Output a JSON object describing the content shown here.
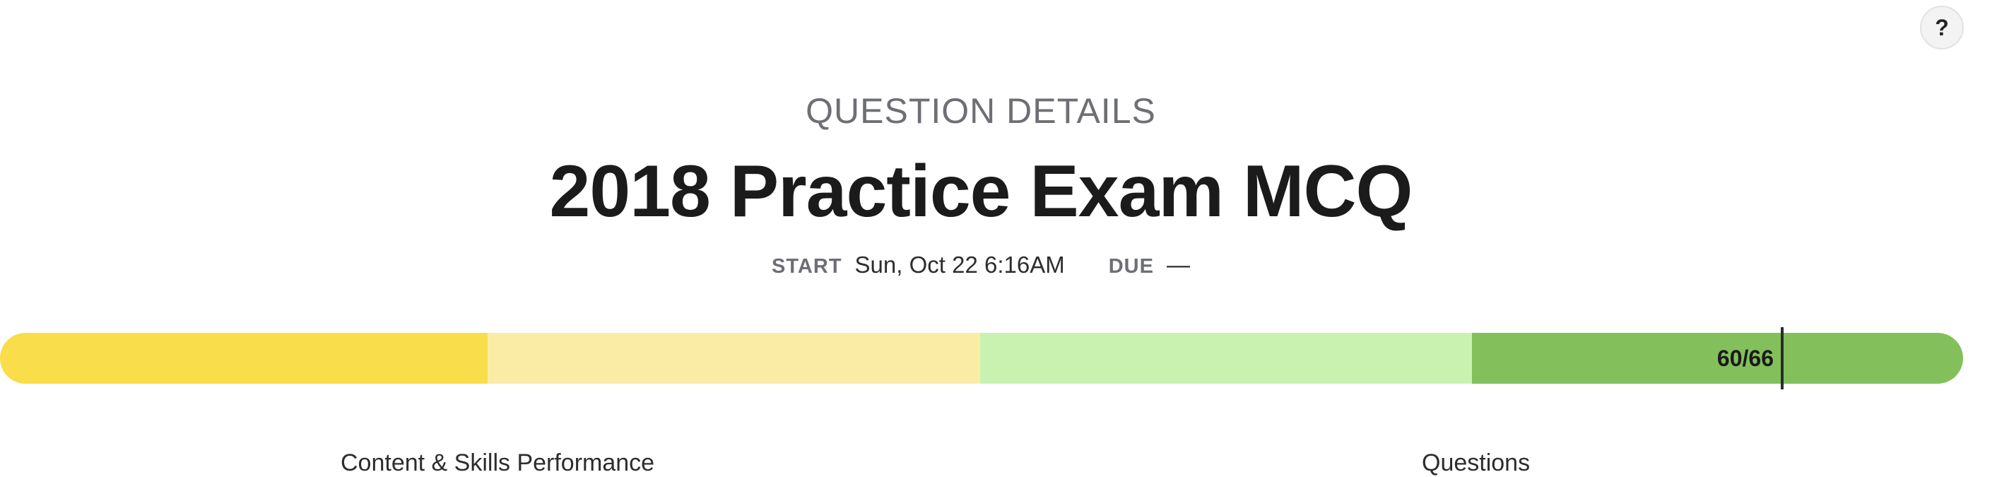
{
  "help": {
    "label": "?"
  },
  "header": {
    "section_label": "QUESTION DETAILS",
    "title": "2018 Practice Exam MCQ",
    "start_label": "START",
    "start_value": "Sun, Oct 22 6:16AM",
    "due_label": "DUE",
    "due_value": "—"
  },
  "progress": {
    "score_text": "60/66",
    "score": 60,
    "total": 66,
    "segment_colors": [
      "#f9dd4a",
      "#fbeca5",
      "#c9f2b0",
      "#83c05b"
    ]
  },
  "sections": {
    "left_heading": "Content & Skills Performance",
    "right_heading": "Questions"
  }
}
